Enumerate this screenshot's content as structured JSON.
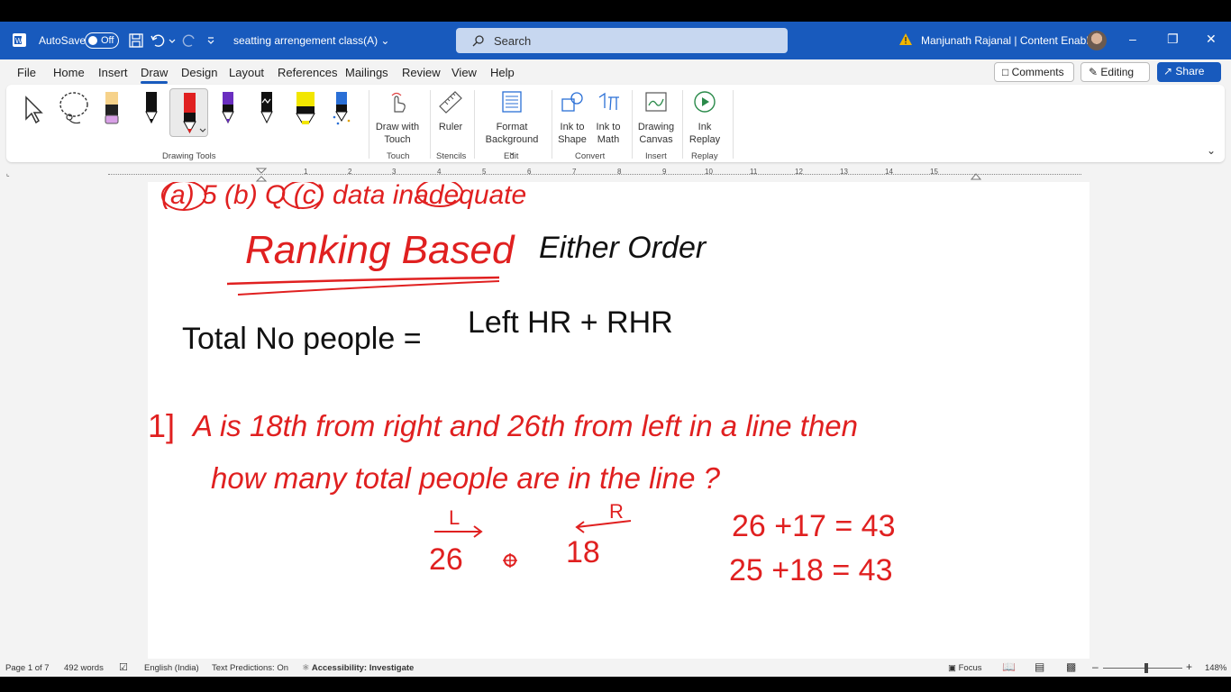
{
  "titlebar": {
    "autosave_label": "AutoSave",
    "autosave_state": "Off",
    "doc_name": "seatting arrengement class(A)",
    "search_placeholder": "Search",
    "user": "Manjunath Rajanal | Content Enablers",
    "accent": "#185abd"
  },
  "menu": {
    "tabs": [
      "File",
      "Home",
      "Insert",
      "Draw",
      "Design",
      "Layout",
      "References",
      "Mailings",
      "Review",
      "View",
      "Help"
    ],
    "active": "Draw",
    "comments": "Comments",
    "editing": "Editing",
    "share": "Share"
  },
  "ribbon": {
    "groups": {
      "drawing_tools": "Drawing Tools",
      "touch": "Touch",
      "stencils": "Stencils",
      "edit": "Edit",
      "convert": "Convert",
      "insert": "Insert",
      "replay": "Replay"
    },
    "buttons": {
      "draw_with_touch_1": "Draw with",
      "draw_with_touch_2": "Touch",
      "ruler": "Ruler",
      "format_bg_1": "Format",
      "format_bg_2": "Background",
      "ink_to_shape_1": "Ink to",
      "ink_to_shape_2": "Shape",
      "ink_to_math_1": "Ink to",
      "ink_to_math_2": "Math",
      "drawing_canvas_1": "Drawing",
      "drawing_canvas_2": "Canvas",
      "ink_replay_1": "Ink",
      "ink_replay_2": "Replay"
    }
  },
  "ruler": {
    "numbers": [
      "1",
      "2",
      "3",
      "4",
      "5",
      "6",
      "7",
      "8",
      "9",
      "10",
      "11",
      "12",
      "13",
      "14",
      "15"
    ]
  },
  "document": {
    "line_top": "(a) 5 (b) Q (c) data inadequate",
    "heading": "Ranking Based",
    "heading_extra": "Either Order",
    "formula_left": "Total No people =",
    "formula_right": "Left HR + RHR",
    "q_number": "1]",
    "q_line1": "A is 18th from right and 26th from left in a line then",
    "q_line2": "how many total people are in the line ?",
    "arrow_left_label": "L",
    "arrow_right_label": "R",
    "val_left": "26",
    "val_right": "18",
    "calc1": "26 +17 = 43",
    "calc2": "25 +18 = 43"
  },
  "status": {
    "page": "Page 1 of 7",
    "words": "492 words",
    "language": "English (India)",
    "text_predictions": "Text Predictions: On",
    "accessibility": "Accessibility: Investigate",
    "focus": "Focus",
    "zoom": "148%"
  }
}
